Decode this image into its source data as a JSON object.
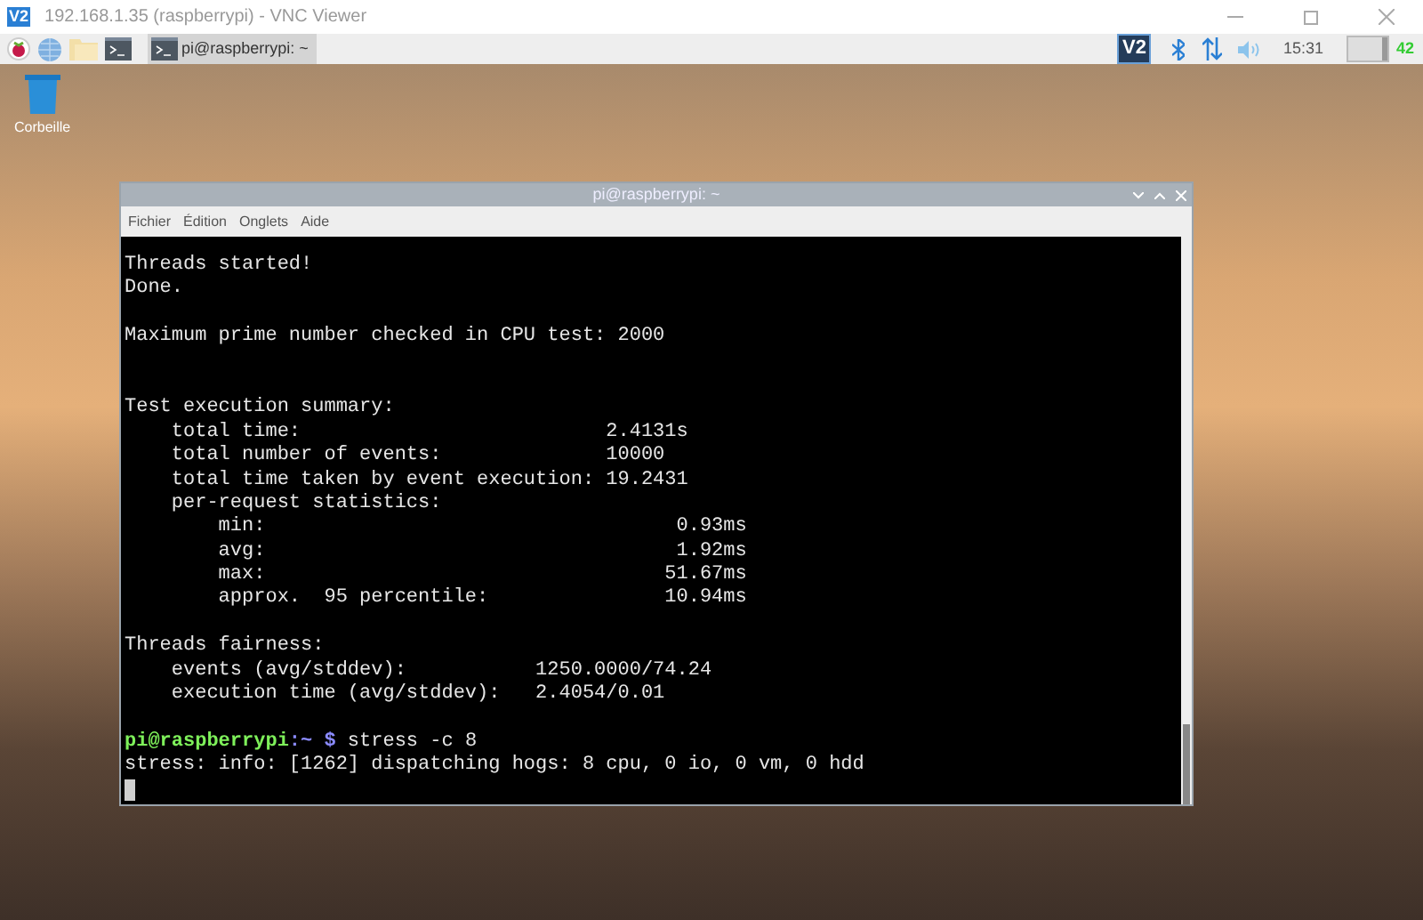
{
  "viewer_window": {
    "logo": "V2",
    "title": "192.168.1.35 (raspberrypi) - VNC Viewer"
  },
  "taskbar": {
    "task": "pi@raspberrypi: ~",
    "tray_logo": "V2",
    "clock": "15:31",
    "cpu_monitor": {
      "reading": "42",
      "level": 0.15
    }
  },
  "desktop_icons": [
    {
      "label": "Corbeille"
    }
  ],
  "terminal": {
    "title": "pi@raspberrypi: ~",
    "menu": [
      "Fichier",
      "Édition",
      "Onglets",
      "Aide"
    ],
    "lines": [
      {
        "kind": "text",
        "text": "Threads started!"
      },
      {
        "kind": "text",
        "text": "Done."
      },
      {
        "kind": "blank"
      },
      {
        "kind": "text",
        "text": "Maximum prime number checked in CPU test: 2000"
      },
      {
        "kind": "blank"
      },
      {
        "kind": "blank"
      },
      {
        "kind": "text",
        "text": "Test execution summary:"
      },
      {
        "kind": "text",
        "text": "    total time:                          2.4131s"
      },
      {
        "kind": "text",
        "text": "    total number of events:              10000"
      },
      {
        "kind": "text",
        "text": "    total time taken by event execution: 19.2431"
      },
      {
        "kind": "text",
        "text": "    per-request statistics:"
      },
      {
        "kind": "text",
        "text": "        min:                                   0.93ms"
      },
      {
        "kind": "text",
        "text": "        avg:                                   1.92ms"
      },
      {
        "kind": "text",
        "text": "        max:                                  51.67ms"
      },
      {
        "kind": "text",
        "text": "        approx.  95 percentile:               10.94ms"
      },
      {
        "kind": "blank"
      },
      {
        "kind": "text",
        "text": "Threads fairness:"
      },
      {
        "kind": "text",
        "text": "    events (avg/stddev):           1250.0000/74.24"
      },
      {
        "kind": "text",
        "text": "    execution time (avg/stddev):   2.4054/0.01"
      },
      {
        "kind": "blank"
      },
      {
        "kind": "prompt",
        "user": "pi@raspberrypi",
        "path": ":~",
        "symbol": "$",
        "command": "stress -c 8"
      },
      {
        "kind": "text",
        "text": "stress: info: [1262] dispatching hogs: 8 cpu, 0 io, 0 vm, 0 hdd"
      },
      {
        "kind": "cursor"
      }
    ]
  }
}
